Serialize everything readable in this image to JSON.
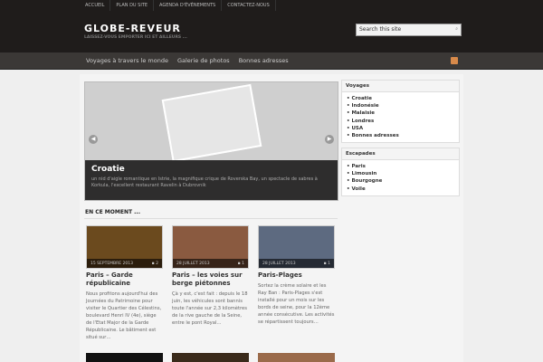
{
  "topbar": [
    "ACCUEIL",
    "PLAN DU SITE",
    "AGENDA D'ÉVÉNEMENTS",
    "CONTACTEZ-NOUS"
  ],
  "site": {
    "title": "GLOBE-REVEUR",
    "tagline": "LAISSEZ-VOUS EMPORTER ICI ET AILLEURS ..."
  },
  "search": {
    "placeholder": "Search this site"
  },
  "nav": [
    "Voyages à travers le monde",
    "Galerie de photos",
    "Bonnes adresses"
  ],
  "slider": {
    "title": "Croatie",
    "text": "un nid d'aigle romantique en Istrie, la magnifique crique de Roverska Bay, un spectacle de sabres à Korkula, l'excellent restaurant Ravelin à Dubrovnik"
  },
  "section_title": "EN CE MOMENT ...",
  "posts": [
    {
      "date": "15 SEPTEMBRE 2013",
      "comments": "2",
      "title": "Paris – Garde républicaine",
      "excerpt": "Nous profitons aujourd'hui des Journées du Patrimoine pour visiter le Quartier des Célestins, boulevard Henri IV (4e), siège de l'Etat Major de la Garde Républicaine. Le bâtiment est situé sur…",
      "color": "#6b4a1e"
    },
    {
      "date": "28 JUILLET 2013",
      "comments": "1",
      "title": "Paris – les voies sur berge piétonnes",
      "excerpt": "Çà y est, c'est fait : depuis le 18 juin, les véhicules sont bannis toute l'année sur 2,3 kilomètres de la rive gauche de la Seine, entre le pont Royal…",
      "color": "#8a5a40"
    },
    {
      "date": "28 JUILLET 2013",
      "comments": "1",
      "title": "Paris-Plages",
      "excerpt": "Sortez la crème solaire et les Ray Ban : Paris-Plages s'est installé pour un mois sur les bords de seine, pour la 12ème année consécutive. Les activités se répartissent toujours…",
      "color": "#5d6a80"
    }
  ],
  "widgets": [
    {
      "title": "Voyages",
      "items": [
        "Croatie",
        "Indonésie",
        "Malaisie",
        "Londres",
        "USA",
        "Bonnes adresses"
      ]
    },
    {
      "title": "Escapades",
      "items": [
        "Paris",
        "Limousin",
        "Bourgogne",
        "Voile"
      ]
    }
  ]
}
